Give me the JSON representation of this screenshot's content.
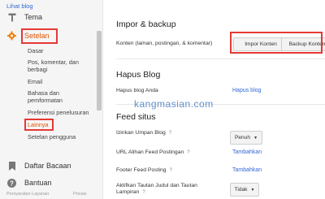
{
  "sidebar": {
    "view_blog": "Lihat blog",
    "theme": "Tema",
    "settings": "Setelan",
    "sub_items": [
      "Dasar",
      "Pos, komentar, dan berbagi",
      "Email",
      "Bahasa dan pemformatan",
      "Preferensi penelusuran",
      "Lainnya",
      "Setelan pengguna"
    ],
    "reading_list": "Daftar Bacaan",
    "help": "Bantuan",
    "footer_left": "Persyaratan Layanan",
    "footer_right": "Privasi"
  },
  "import_backup": {
    "title": "Impor & backup",
    "content_label": "Konten (laman, postingan, & komentar)",
    "import_button": "Impor Konten",
    "backup_button": "Backup Konten"
  },
  "delete_blog": {
    "title": "Hapus Blog",
    "label": "Hapus blog Anda",
    "link": "Hapus blog"
  },
  "feed": {
    "title": "Feed situs",
    "allow_label": "Izinkan Umpan Blog",
    "allow_value": "Penuh",
    "redirect_label": "URL Alihan Feed Postingan",
    "redirect_link": "Tambahkan",
    "footer_label": "Footer Feed Posting",
    "footer_link": "Tambahkan",
    "enclosure_label": "Aktifkan Tautan Judul dan Tautan Lampiran",
    "enclosure_value": "Tidak"
  },
  "watermark": "kangmasian.com",
  "colors": {
    "accent": "#3367d6",
    "settings_icon": "#f57c00",
    "highlight": "#e53935"
  }
}
